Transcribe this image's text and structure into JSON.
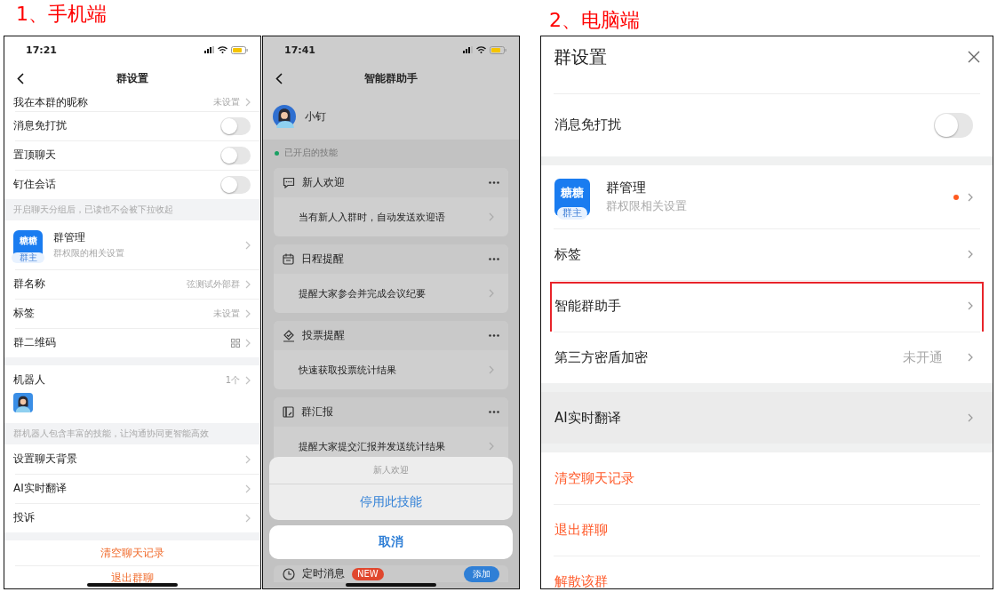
{
  "mobile_label": "1、手机端",
  "desktop_label": "2、电脑端",
  "phone_settings": {
    "time": "17:21",
    "title": "群设置",
    "sections": [
      {
        "rows": [
          {
            "kind": "link",
            "label": "我在本群的昵称",
            "value": "未设置"
          },
          {
            "kind": "toggle",
            "label": "消息免打扰",
            "on": false
          },
          {
            "kind": "toggle",
            "label": "置顶聊天",
            "on": false
          },
          {
            "kind": "toggle",
            "label": "钉住会话",
            "on": false
          }
        ],
        "footer": "开启聊天分组后，已读也不会被下拉收起"
      },
      {
        "rows": [
          {
            "kind": "manage",
            "label": "群管理",
            "subtitle": "群权限的相关设置",
            "icon_text": "糖糖",
            "role_badge": "群主"
          },
          {
            "kind": "link",
            "label": "群名称",
            "value": "弦测试外部群"
          },
          {
            "kind": "link",
            "label": "标签",
            "value": "未设置"
          },
          {
            "kind": "qr",
            "label": "群二维码"
          }
        ]
      },
      {
        "rows": [
          {
            "kind": "robot",
            "label": "机器人",
            "value": "1个"
          }
        ],
        "footer": "群机器人包含丰富的技能，让沟通协同更智能高效"
      },
      {
        "rows": [
          {
            "kind": "link",
            "label": "设置聊天背景"
          },
          {
            "kind": "link",
            "label": "AI实时翻译"
          },
          {
            "kind": "link",
            "label": "投诉"
          }
        ]
      },
      {
        "rows": [
          {
            "kind": "danger",
            "label": "清空聊天记录"
          },
          {
            "kind": "danger",
            "label": "退出群聊"
          }
        ]
      }
    ]
  },
  "phone_assistant": {
    "time": "17:41",
    "title": "智能群助手",
    "bot_name": "小钉",
    "section_label": "已开启的技能",
    "skills": [
      {
        "kind": "chat",
        "title": "新人欢迎",
        "description": "当有新人入群时，自动发送欢迎语"
      },
      {
        "kind": "calendar",
        "title": "日程提醒",
        "description": "提醒大家参会并完成会议纪要"
      },
      {
        "kind": "vote",
        "title": "投票提醒",
        "description": "快速获取投票统计结果"
      },
      {
        "kind": "report",
        "title": "群汇报",
        "description": "提醒大家提交汇报并发送统计结果"
      }
    ],
    "next_skill": {
      "kind": "clock",
      "title": "定时消息",
      "badge": "NEW",
      "button": "添加"
    },
    "sheet": {
      "title": "新人欢迎",
      "action": "停用此技能",
      "cancel": "取消"
    }
  },
  "desktop_settings": {
    "title": "群设置",
    "sections": [
      {
        "rows": [
          {
            "kind": "toggle",
            "label": "消息免打扰",
            "on": false,
            "highlighted": false,
            "hovered": false
          }
        ]
      },
      {
        "rows": [
          {
            "kind": "manage",
            "label": "群管理",
            "subtitle": "群权限相关设置",
            "icon_text": "糖糖",
            "role_badge": "群主",
            "notice_dot": true,
            "highlighted": false,
            "hovered": false
          },
          {
            "kind": "link",
            "label": "标签",
            "highlighted": false,
            "hovered": false
          },
          {
            "kind": "link",
            "label": "智能群助手",
            "highlighted": true,
            "hovered": false
          },
          {
            "kind": "link",
            "label": "第三方密盾加密",
            "value": "未开通",
            "highlighted": false,
            "hovered": false
          }
        ]
      },
      {
        "rows": [
          {
            "kind": "link",
            "label": "AI实时翻译",
            "highlighted": false,
            "hovered": true
          }
        ]
      },
      {
        "rows": [
          {
            "kind": "danger",
            "label": "清空聊天记录",
            "highlighted": false,
            "hovered": false
          },
          {
            "kind": "danger",
            "label": "退出群聊",
            "highlighted": false,
            "hovered": false
          },
          {
            "kind": "danger",
            "label": "解散该群",
            "highlighted": false,
            "hovered": false
          }
        ]
      }
    ]
  }
}
